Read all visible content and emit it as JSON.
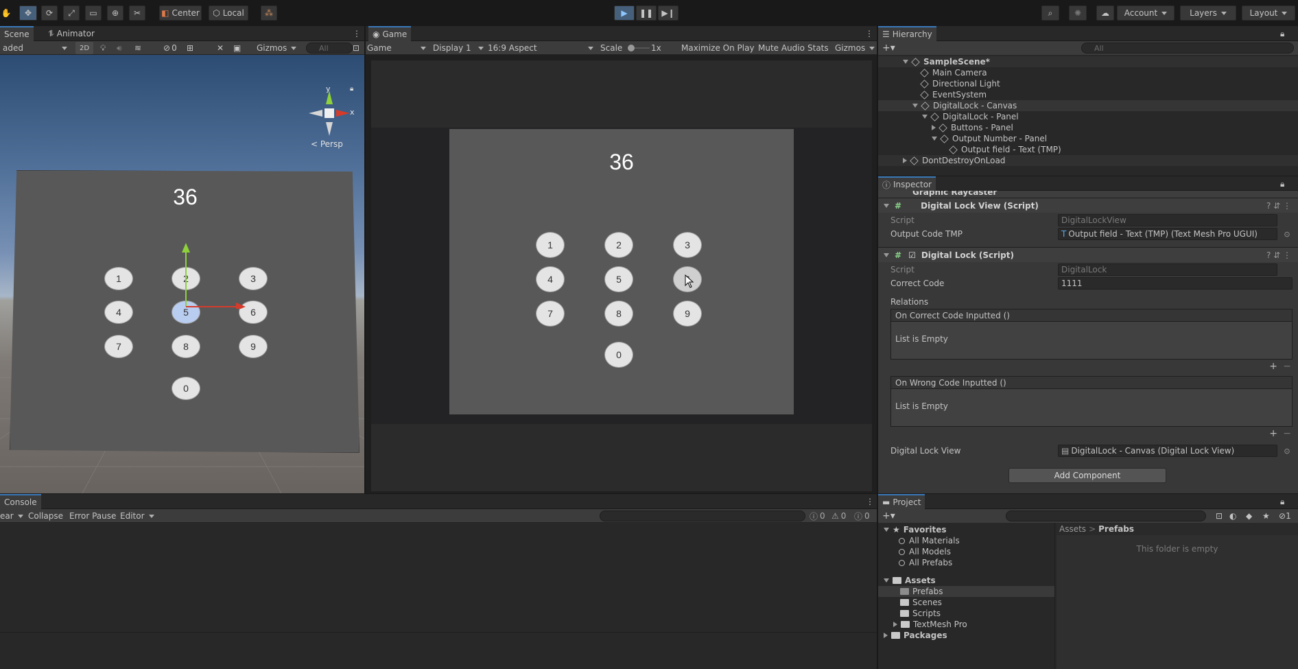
{
  "toolbar": {
    "pivot": "Center",
    "space": "Local",
    "account": "Account",
    "layers": "Layers",
    "layout": "Layout"
  },
  "scene": {
    "tab_scene": "Scene",
    "tab_animator": "Animator",
    "shading": "aded",
    "mode_2d": "2D",
    "hidden_count": "0",
    "gizmos": "Gizmos",
    "search_placeholder": "All",
    "persp": "< Persp",
    "gizmo_y": "y",
    "gizmo_x": "x",
    "output": "36",
    "buttons": [
      "1",
      "2",
      "3",
      "4",
      "5",
      "6",
      "7",
      "8",
      "9",
      "0"
    ]
  },
  "game": {
    "tab": "Game",
    "view_mode": "Game",
    "display": "Display 1",
    "aspect": "16:9 Aspect",
    "scale_label": "Scale",
    "scale_value": "1x",
    "maximize": "Maximize On Play",
    "mute": "Mute Audio",
    "stats": "Stats",
    "gizmos": "Gizmos",
    "output": "36",
    "buttons": [
      "1",
      "2",
      "3",
      "4",
      "5",
      "6",
      "7",
      "8",
      "9",
      "0"
    ]
  },
  "hierarchy": {
    "tab": "Hierarchy",
    "search_placeholder": "All",
    "items": [
      "SampleScene*",
      "Main Camera",
      "Directional Light",
      "EventSystem",
      "DigitalLock - Canvas",
      "DigitalLock - Panel",
      "Buttons - Panel",
      "Output Number - Panel",
      "Output field - Text (TMP)",
      "DontDestroyOnLoad"
    ]
  },
  "inspector": {
    "tab": "Inspector",
    "graphic_raycaster": "Graphic Raycaster",
    "view_component": "Digital Lock View (Script)",
    "script_label": "Script",
    "view_script": "DigitalLockView",
    "output_label": "Output Code TMP",
    "output_value": "Output field - Text (TMP) (Text Mesh Pro UGUI)",
    "lock_component": "Digital Lock (Script)",
    "lock_script": "DigitalLock",
    "correct_label": "Correct Code",
    "correct_value": "1111",
    "relations": "Relations",
    "event1": "On Correct Code Inputted ()",
    "event2": "On Wrong Code Inputted ()",
    "empty": "List is Empty",
    "view_label": "Digital Lock View",
    "view_value": "DigitalLock - Canvas (Digital Lock View)",
    "add_component": "Add Component"
  },
  "console": {
    "tab": "Console",
    "clear": "ear",
    "collapse": "Collapse",
    "error_pause": "Error Pause",
    "editor": "Editor",
    "log_count": "0",
    "warn_count": "0",
    "error_count": "0"
  },
  "project": {
    "tab": "Project",
    "favorites": "Favorites",
    "fav_items": [
      "All Materials",
      "All Models",
      "All Prefabs"
    ],
    "assets": "Assets",
    "asset_items": [
      "Prefabs",
      "Scenes",
      "Scripts",
      "TextMesh Pro"
    ],
    "packages": "Packages",
    "crumb_root": "Assets",
    "crumb_sep": ">",
    "crumb_current": "Prefabs",
    "empty_msg": "This folder is empty",
    "count": "1"
  }
}
